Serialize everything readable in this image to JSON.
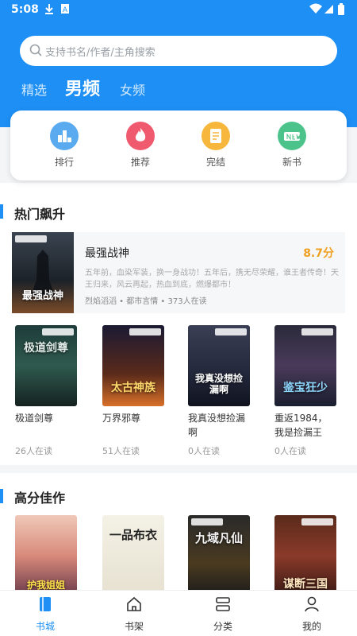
{
  "status_bar": {
    "time": "5:08"
  },
  "search": {
    "placeholder": "支持书名/作者/主角搜索"
  },
  "tabs": [
    {
      "label": "精选",
      "active": false
    },
    {
      "label": "男频",
      "active": true
    },
    {
      "label": "女频",
      "active": false
    }
  ],
  "categories": [
    {
      "label": "排行",
      "icon": "ranking-icon",
      "color": "#5aaaf0"
    },
    {
      "label": "推荐",
      "icon": "flame-icon",
      "color": "#f05a6e"
    },
    {
      "label": "完结",
      "icon": "document-icon",
      "color": "#f6b73c"
    },
    {
      "label": "新书",
      "icon": "new-book-icon",
      "color": "#4cc38a"
    }
  ],
  "hot_section": {
    "title": "热门飙升",
    "featured": {
      "title": "最强战神",
      "score": "8.7分",
      "desc": "五年前，血染军装，换一身战功！五年后，携无尽荣耀，谁王者传奇！天王归来，风云再起，热血到底，燃爆都市！",
      "meta": "烈焰滔滔 • 都市言情 • 373人在读",
      "cover_text": "最强战神"
    },
    "books": [
      {
        "title": "极道剑尊",
        "readers": "26人在读",
        "cover_text": "极道剑尊"
      },
      {
        "title": "万界邪尊",
        "readers": "51人在读",
        "cover_text": "太古神族"
      },
      {
        "title": "我真没想捡漏啊",
        "readers": "0人在读",
        "cover_text": "我真没想捡漏啊"
      },
      {
        "title": "重返1984，我是捡漏王",
        "readers": "0人在读",
        "cover_text": "鉴宝狂少"
      }
    ]
  },
  "high_section": {
    "title": "高分佳作",
    "books": [
      {
        "cover_text": "护我姐姐"
      },
      {
        "cover_text": "一品布衣"
      },
      {
        "cover_text": "九域凡仙"
      },
      {
        "cover_text": "谋断三国"
      }
    ]
  },
  "bottom_nav": [
    {
      "label": "书城",
      "icon": "bookstore-icon",
      "active": true
    },
    {
      "label": "书架",
      "icon": "bookshelf-icon",
      "active": false
    },
    {
      "label": "分类",
      "icon": "category-icon",
      "active": false
    },
    {
      "label": "我的",
      "icon": "profile-icon",
      "active": false
    }
  ],
  "colors": {
    "accent": "#1d8ff5",
    "score": "#f0a020"
  }
}
